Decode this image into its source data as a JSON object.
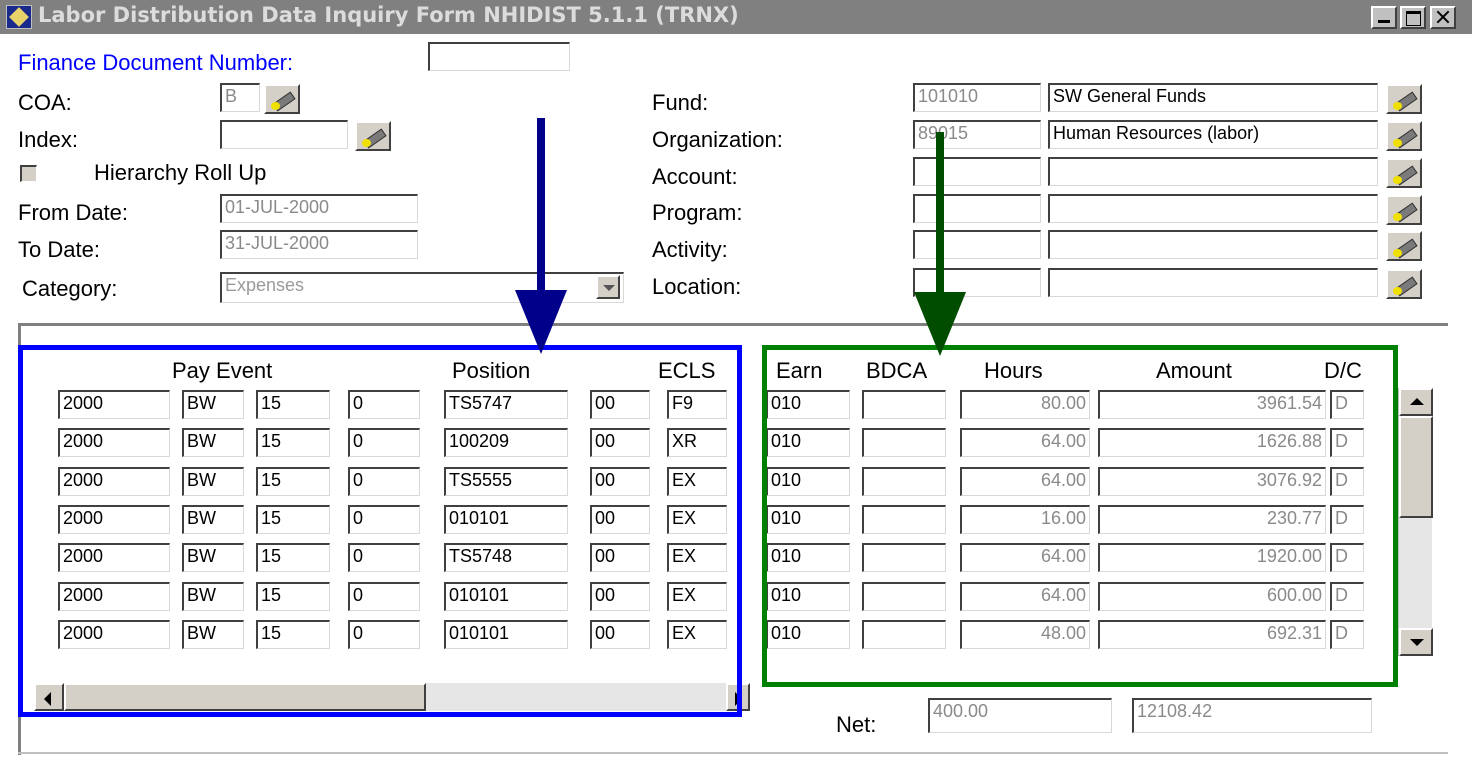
{
  "window": {
    "title": "Labor Distribution Data Inquiry Form  NHIDIST  5.1.1  (TRNX)"
  },
  "header": {
    "finance_doc_label": "Finance Document Number:",
    "finance_doc_value": "",
    "coa_label": "COA:",
    "coa_value": "B",
    "index_label": "Index:",
    "index_value": "",
    "hierarchy_label": "Hierarchy Roll Up",
    "hierarchy_checked": false,
    "from_date_label": "From Date:",
    "from_date_value": "01-JUL-2000",
    "to_date_label": "To Date:",
    "to_date_value": "31-JUL-2000",
    "category_label": "Category:",
    "category_value": "Expenses"
  },
  "foapal": {
    "fund_label": "Fund:",
    "fund_code": "101010",
    "fund_title": "SW General Funds",
    "org_label": "Organization:",
    "org_code": "89015",
    "org_title": "Human Resources (labor)",
    "account_label": "Account:",
    "account_code": "",
    "account_title": "",
    "program_label": "Program:",
    "program_code": "",
    "program_title": "",
    "activity_label": "Activity:",
    "activity_code": "",
    "activity_title": "",
    "location_label": "Location:",
    "location_code": "",
    "location_title": ""
  },
  "grid": {
    "headers": {
      "pay_event": "Pay Event",
      "position": "Position",
      "ecls": "ECLS",
      "earn": "Earn",
      "bdca": "BDCA",
      "hours": "Hours",
      "amount": "Amount",
      "dc": "D/C"
    },
    "rows": [
      [
        "2000",
        "BW",
        "15",
        "0",
        "TS5747",
        "00",
        "F9",
        "010",
        "",
        "80.00",
        "3961.54",
        "D"
      ],
      [
        "2000",
        "BW",
        "15",
        "0",
        "100209",
        "00",
        "XR",
        "010",
        "",
        "64.00",
        "1626.88",
        "D"
      ],
      [
        "2000",
        "BW",
        "15",
        "0",
        "TS5555",
        "00",
        "EX",
        "010",
        "",
        "64.00",
        "3076.92",
        "D"
      ],
      [
        "2000",
        "BW",
        "15",
        "0",
        "010101",
        "00",
        "EX",
        "010",
        "",
        "16.00",
        "230.77",
        "D"
      ],
      [
        "2000",
        "BW",
        "15",
        "0",
        "TS5748",
        "00",
        "EX",
        "010",
        "",
        "64.00",
        "1920.00",
        "D"
      ],
      [
        "2000",
        "BW",
        "15",
        "0",
        "010101",
        "00",
        "EX",
        "010",
        "",
        "64.00",
        "600.00",
        "D"
      ],
      [
        "2000",
        "BW",
        "15",
        "0",
        "010101",
        "00",
        "EX",
        "010",
        "",
        "48.00",
        "692.31",
        "D"
      ]
    ]
  },
  "totals": {
    "net_label": "Net:",
    "net_hours": "400.00",
    "net_amount": "12108.42"
  },
  "annotations": {
    "blue_color": "#0000ff",
    "green_color": "#008000",
    "blue_arrow_color": "#00008b",
    "green_arrow_color": "#004d00"
  }
}
